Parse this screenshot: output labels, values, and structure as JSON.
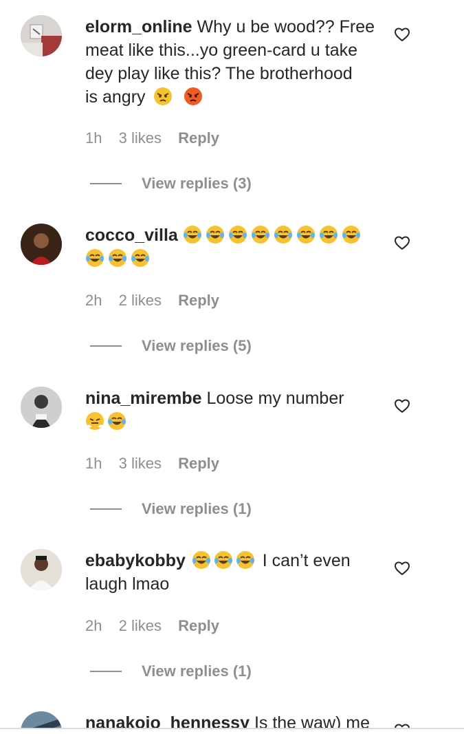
{
  "comments": [
    {
      "username": "elorm_online",
      "text_lines": [
        "Why u be wood?? Free",
        "meat like this...yo green-card u take",
        "dey play like this? The brotherhood",
        "is angry"
      ],
      "trailing_emojis": [
        "angry-face-emoji",
        "pouting-face-emoji"
      ],
      "time": "1h",
      "likes": "3 likes",
      "reply_label": "Reply",
      "view_replies": "View replies (3)"
    },
    {
      "username": "cocco_villa",
      "emojis": [
        "laughing-tears-emoji",
        "laughing-tears-emoji",
        "laughing-tears-emoji",
        "laughing-tears-emoji",
        "laughing-tears-emoji",
        "laughing-tears-emoji",
        "laughing-tears-emoji",
        "laughing-tears-emoji",
        "laughing-tears-emoji",
        "laughing-tears-emoji",
        "laughing-tears-emoji"
      ],
      "time": "2h",
      "likes": "2 likes",
      "reply_label": "Reply",
      "view_replies": "View replies (5)"
    },
    {
      "username": "nina_mirembe",
      "text": "Loose my number",
      "trailing_emojis": [
        "steam-nose-emoji",
        "laughing-tears-emoji"
      ],
      "time": "1h",
      "likes": "3 likes",
      "reply_label": "Reply",
      "view_replies": "View replies (1)"
    },
    {
      "username": "ebabykobby",
      "leading_emojis": [
        "laughing-tears-emoji",
        "laughing-tears-emoji",
        "laughing-tears-emoji"
      ],
      "text": "I can’t even",
      "text_line2": "laugh lmao",
      "time": "2h",
      "likes": "2 likes",
      "reply_label": "Reply",
      "view_replies": "View replies (1)"
    },
    {
      "username": "nanakojo_hennessy",
      "text": "Is the waw) me"
    }
  ],
  "colors": {
    "text": "#262626",
    "secondary": "#8e8e8e",
    "emoji_yellow": "#f7c232",
    "emoji_angry": "#f05a24"
  }
}
